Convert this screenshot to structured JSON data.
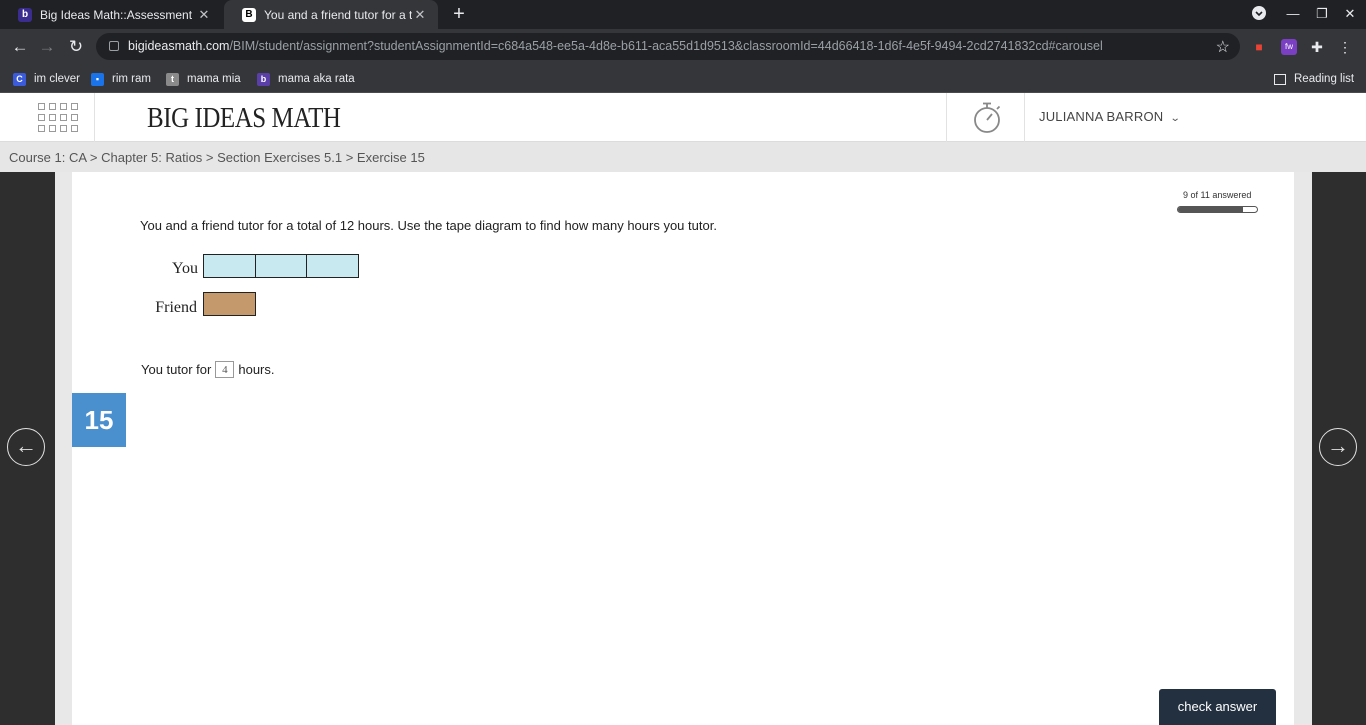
{
  "browser": {
    "tabs": [
      {
        "title": "Big Ideas Math::Assessment",
        "active": false,
        "icon": "big-ideas-favicon"
      },
      {
        "title": "You and a friend tutor for a total",
        "active": true,
        "icon": "brainly-favicon"
      }
    ],
    "url_host": "bigideasmath.com",
    "url_path": "/BIM/student/assignment?studentAssignmentId=c684a548-ee5a-4d8e-b611-aca55d1d9513&classroomId=44d66418-1d6f-4e5f-9494-2cd2741832cd#carousel",
    "bookmarks": [
      {
        "label": "im clever",
        "icon": "clever-icon",
        "color": "#3b5bdb"
      },
      {
        "label": "rim ram",
        "icon": "classroom-icon",
        "color": "#1a73e8"
      },
      {
        "label": "mama mia",
        "icon": "tumblr-icon",
        "color": "#8a8a8a"
      },
      {
        "label": "mama aka rata",
        "icon": "big-ideas-icon",
        "color": "#5b3fa8"
      }
    ],
    "reading_list": "Reading list"
  },
  "app": {
    "logo": "BIG IDEAS MATH",
    "user_name": "JULIANNA BARRON"
  },
  "breadcrumb": "Course 1: CA > Chapter 5: Ratios > Section Exercises 5.1 > Exercise 15",
  "progress": {
    "text": "9 of 11 answered",
    "answered": 9,
    "total": 11
  },
  "question": {
    "prompt": "You and a friend tutor for a total of 12 hours.  Use the tape diagram to find how many hours you tutor.",
    "tape_you_label": "You",
    "tape_friend_label": "Friend",
    "you_units": 3,
    "friend_units": 1,
    "answer_prefix": "You tutor for",
    "answer_value": "4",
    "answer_suffix": "hours.",
    "exercise_number": "15"
  },
  "colors": {
    "you_tape": "#c9e9f1",
    "friend_tape": "#c49a6c",
    "exercise_badge": "#4a8fce",
    "check_button": "#233040"
  },
  "actions": {
    "check_answer": "check answer"
  }
}
